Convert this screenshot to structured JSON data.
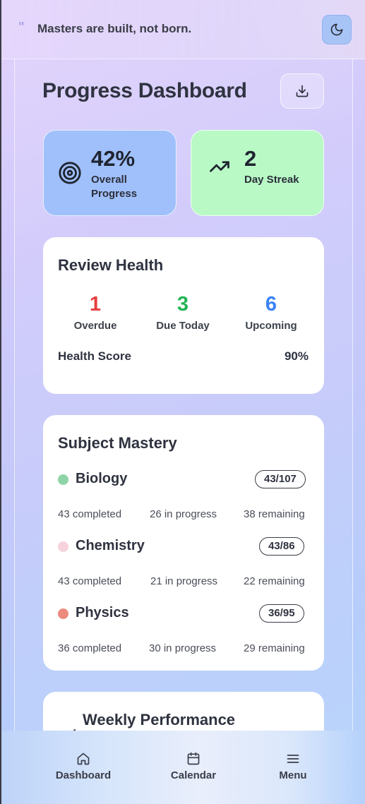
{
  "quote": {
    "mark": "\"",
    "text": "Masters are built, not born."
  },
  "header": {
    "title": "Progress Dashboard"
  },
  "stats": {
    "overall": {
      "value": "42%",
      "label": "Overall Progress",
      "icon": "target-icon",
      "color": "#a0c0fb"
    },
    "streak": {
      "value": "2",
      "label": "Day Streak",
      "icon": "trending-up-icon",
      "color": "#b9f9c6"
    }
  },
  "review_health": {
    "title": "Review Health",
    "overdue": {
      "value": "1",
      "label": "Overdue",
      "color": "#e53e3e"
    },
    "due_today": {
      "value": "3",
      "label": "Due Today",
      "color": "#22b552"
    },
    "upcoming": {
      "value": "6",
      "label": "Upcoming",
      "color": "#3b82f6"
    },
    "health_score_label": "Health Score",
    "health_score_value": "90%"
  },
  "subject_mastery": {
    "title": "Subject Mastery",
    "subjects": [
      {
        "name": "Biology",
        "badge": "43/107",
        "completed": "43 completed",
        "in_progress": "26 in progress",
        "remaining": "38 remaining",
        "color": "#8fd4a8"
      },
      {
        "name": "Chemistry",
        "badge": "43/86",
        "completed": "43 completed",
        "in_progress": "21 in progress",
        "remaining": "22 remaining",
        "color": "#f6d3dc"
      },
      {
        "name": "Physics",
        "badge": "36/95",
        "completed": "36 completed",
        "in_progress": "30 in progress",
        "remaining": "29 remaining",
        "color": "#ec8a7e"
      }
    ]
  },
  "weekly": {
    "title": "Weekly Performance"
  },
  "nav": {
    "dashboard": "Dashboard",
    "calendar": "Calendar",
    "menu": "Menu"
  }
}
